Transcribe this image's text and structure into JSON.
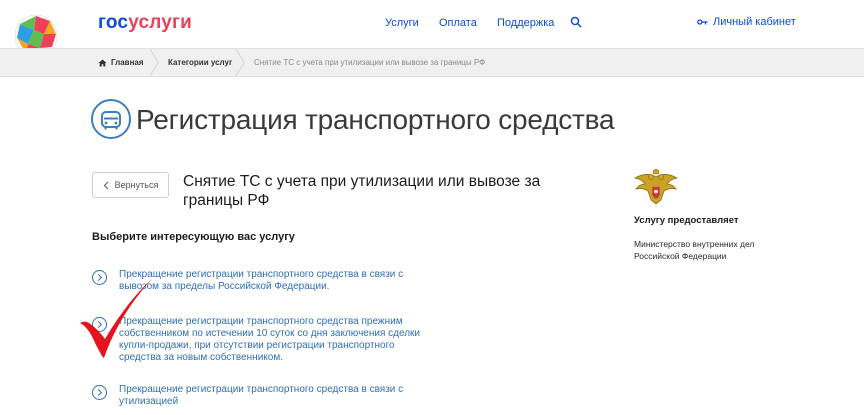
{
  "header": {
    "brand_part1": "гос",
    "brand_part2": "услуги",
    "nav": [
      {
        "label": "Услуги"
      },
      {
        "label": "Оплата"
      },
      {
        "label": "Поддержка"
      }
    ],
    "cabinet_label": "Личный кабинет"
  },
  "breadcrumb": {
    "home": "Главная",
    "category": "Категории услуг",
    "current": "Снятие ТС с учета при утилизации или вывозе за границы РФ"
  },
  "page": {
    "title": "Регистрация транспортного средства",
    "back_label": "Вернуться",
    "service_title": "Снятие ТС с учета при утилизации или вывозе за границы РФ",
    "section_heading": "Выберите интересующую вас услугу",
    "options": [
      {
        "text": "Прекращение регистрации транспортного средства в связи с вывозом за пределы Российской Федерации."
      },
      {
        "text": "Прекращение регистрации транспортного средства прежним собственником по истечении 10 суток со дня заключения сделки купли-продажи, при отсутствии регистрации транспортного средства за новым собственником."
      },
      {
        "text": "Прекращение регистрации транспортного средства в связи с утилизацией"
      }
    ]
  },
  "sidebar": {
    "provider_heading": "Услугу предоставляет",
    "provider_name": "Министерство внутренних дел Российской Федерации"
  },
  "colors": {
    "brand_blue": "#0d4cd3",
    "brand_red": "#ee3f58",
    "link_blue": "#2f6fb5",
    "annotation_red": "#e3141b"
  },
  "icons": [
    "gosuslugi-logo-icon",
    "search-icon",
    "key-icon",
    "home-icon",
    "car-icon",
    "chevron-left-icon",
    "chevron-right-circle-icon",
    "coat-of-arms-icon",
    "red-checkmark-icon"
  ]
}
